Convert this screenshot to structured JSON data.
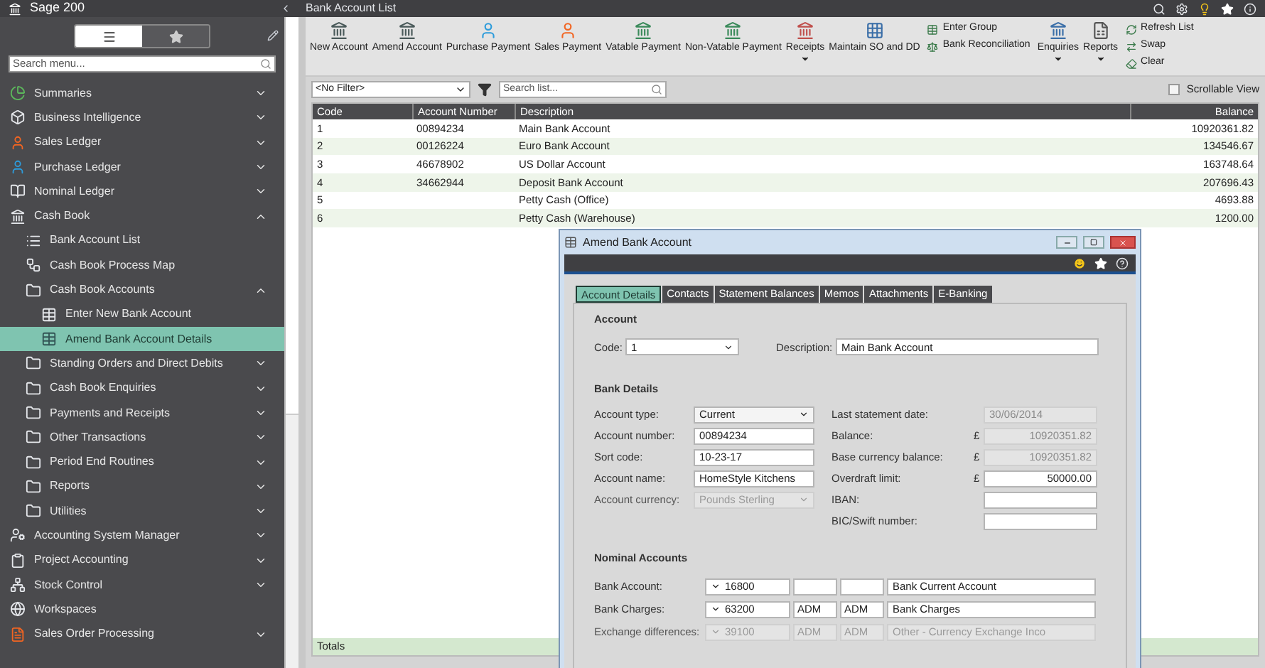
{
  "app": {
    "title": "Sage 200",
    "page_title": "Bank Account List"
  },
  "sidebar": {
    "search": {
      "placeholder": "Search menu..."
    },
    "view_toggle": [
      {
        "selected": true
      },
      {
        "selected": false
      }
    ],
    "items": [
      {
        "label": "Summaries",
        "expanded": false,
        "selected": false
      },
      {
        "label": "Business Intelligence",
        "expanded": false,
        "selected": false
      },
      {
        "label": "Sales Ledger",
        "expanded": false,
        "selected": false
      },
      {
        "label": "Purchase Ledger",
        "expanded": false,
        "selected": false
      },
      {
        "label": "Nominal Ledger",
        "expanded": false,
        "selected": false
      },
      {
        "label": "Cash Book",
        "expanded": true,
        "selected": false,
        "children": [
          {
            "label": "Bank Account List",
            "kind": "page",
            "selected": false
          },
          {
            "label": "Cash Book Process Map",
            "kind": "page",
            "selected": false
          },
          {
            "label": "Cash Book Accounts",
            "kind": "folder",
            "expanded": true,
            "selected": false,
            "children": [
              {
                "label": "Enter New Bank Account",
                "selected": false
              },
              {
                "label": "Amend Bank Account Details",
                "selected": true
              }
            ]
          },
          {
            "label": "Standing Orders and Direct Debits",
            "kind": "folder",
            "expanded": false,
            "selected": false
          },
          {
            "label": "Cash Book Enquiries",
            "kind": "folder",
            "expanded": false,
            "selected": false
          },
          {
            "label": "Payments and Receipts",
            "kind": "folder",
            "expanded": false,
            "selected": false
          },
          {
            "label": "Other Transactions",
            "kind": "folder",
            "expanded": false,
            "selected": false
          },
          {
            "label": "Period End Routines",
            "kind": "folder",
            "expanded": false,
            "selected": false
          },
          {
            "label": "Reports",
            "kind": "folder",
            "expanded": false,
            "selected": false
          },
          {
            "label": "Utilities",
            "kind": "folder",
            "expanded": false,
            "selected": false
          }
        ]
      },
      {
        "label": "Accounting System Manager",
        "expanded": false,
        "selected": false
      },
      {
        "label": "Project Accounting",
        "expanded": false,
        "selected": false
      },
      {
        "label": "Stock Control",
        "expanded": false,
        "selected": false
      },
      {
        "label": "Workspaces",
        "selected": false
      },
      {
        "label": "Sales Order Processing",
        "expanded": false,
        "selected": false
      }
    ]
  },
  "toolbar": {
    "items": [
      {
        "kind": "large",
        "label": "New Account",
        "dropdown": false
      },
      {
        "kind": "large",
        "label": "Amend Account",
        "dropdown": false
      },
      {
        "kind": "large",
        "label": "Purchase Payment",
        "dropdown": false
      },
      {
        "kind": "large",
        "label": "Sales Payment",
        "dropdown": false
      },
      {
        "kind": "large",
        "label": "Vatable Payment",
        "dropdown": false
      },
      {
        "kind": "large",
        "label": "Non-Vatable Payment",
        "dropdown": false
      },
      {
        "kind": "large",
        "label": "Receipts",
        "dropdown": true
      },
      {
        "kind": "large",
        "label": "Maintain SO and DD",
        "dropdown": false
      },
      {
        "kind": "stack",
        "entries": [
          "Enter Group",
          "Bank Reconciliation"
        ]
      },
      {
        "kind": "large",
        "label": "Enquiries",
        "dropdown": true
      },
      {
        "kind": "large",
        "label": "Reports",
        "dropdown": true
      },
      {
        "kind": "stack",
        "entries": [
          "Refresh List",
          "Swap",
          "Clear"
        ]
      }
    ]
  },
  "filter": {
    "value": "<No Filter>",
    "search_placeholder": "Search list...",
    "scrollable_view": {
      "label": "Scrollable View",
      "checked": false
    }
  },
  "table": {
    "columns": [
      "Code",
      "Account Number",
      "Description",
      "Balance"
    ],
    "rows": [
      [
        "1",
        "00894234",
        "Main Bank Account",
        "10920361.82"
      ],
      [
        "2",
        "00126224",
        "Euro Bank Account",
        "134546.67"
      ],
      [
        "3",
        "46678902",
        "US Dollar Account",
        "163748.64"
      ],
      [
        "4",
        "34662944",
        "Deposit Bank Account",
        "207696.43"
      ],
      [
        "5",
        "",
        "Petty Cash (Office)",
        "4693.88"
      ],
      [
        "6",
        "",
        "Petty Cash (Warehouse)",
        "1200.00"
      ]
    ],
    "totals_label": "Totals"
  },
  "dialog": {
    "title": "Amend Bank Account",
    "tabs": [
      {
        "label": "Account Details",
        "selected": true
      },
      {
        "label": "Contacts",
        "selected": false
      },
      {
        "label": "Statement Balances",
        "selected": false
      },
      {
        "label": "Memos",
        "selected": false
      },
      {
        "label": "Attachments",
        "selected": false
      },
      {
        "label": "E-Banking",
        "selected": false
      }
    ],
    "account": {
      "heading": "Account",
      "code": {
        "label": "Code:",
        "value": "1"
      },
      "description": {
        "label": "Description:",
        "value": "Main Bank Account"
      }
    },
    "bank_details": {
      "heading": "Bank Details",
      "left": [
        {
          "label": "Account type:",
          "value": "Current",
          "kind": "select",
          "disabled": false
        },
        {
          "label": "Account number:",
          "value": "00894234",
          "kind": "text",
          "disabled": false
        },
        {
          "label": "Sort code:",
          "value": "10-23-17",
          "kind": "text",
          "disabled": false
        },
        {
          "label": "Account name:",
          "value": "HomeStyle Kitchens",
          "kind": "text",
          "disabled": false
        },
        {
          "label": "Account currency:",
          "value": "Pounds Sterling",
          "kind": "select",
          "disabled": true
        }
      ],
      "right": [
        {
          "label": "Last statement date:",
          "value": "30/06/2014",
          "disabled": true
        },
        {
          "label": "Balance:",
          "currency": "£",
          "value": "10920351.82",
          "disabled": true
        },
        {
          "label": "Base currency balance:",
          "currency": "£",
          "value": "10920351.82",
          "disabled": true
        },
        {
          "label": "Overdraft limit:",
          "currency": "£",
          "value": "50000.00",
          "disabled": false
        },
        {
          "label": "IBAN:",
          "disabled": false
        },
        {
          "label": "BIC/Swift number:",
          "disabled": false
        }
      ]
    },
    "nominal_accounts": {
      "heading": "Nominal Accounts",
      "rows": [
        {
          "label": "Bank Account:",
          "code": "16800",
          "cost_centre": "",
          "department": "",
          "name": "Bank Current Account",
          "disabled": false
        },
        {
          "label": "Bank Charges:",
          "code": "63200",
          "cost_centre": "ADM",
          "department": "ADM",
          "name": "Bank Charges",
          "disabled": false
        },
        {
          "label": "Exchange differences:",
          "code": "39100",
          "cost_centre": "ADM",
          "department": "ADM",
          "name": "Other - Currency Exchange Inco",
          "disabled": true
        }
      ]
    }
  }
}
